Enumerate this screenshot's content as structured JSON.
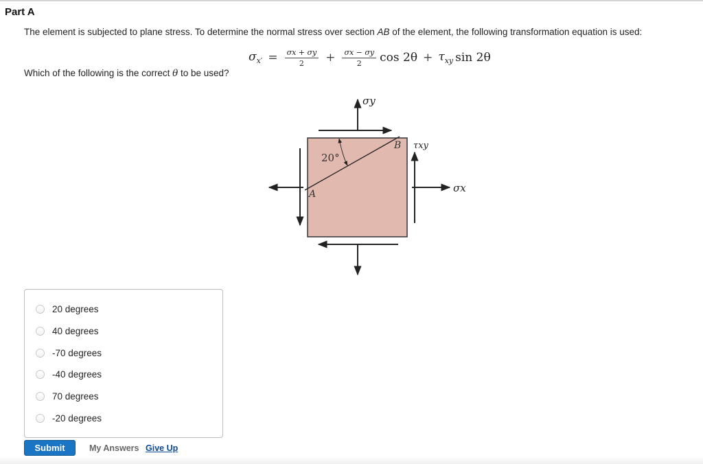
{
  "part": {
    "title": "Part A"
  },
  "intro": {
    "before": "The element is subjected to plane stress. To determine the normal stress over section ",
    "section": "AB",
    "after": " of the element, the following transformation equation is used:"
  },
  "equation": {
    "lhs": "σ",
    "lhs_sub": "x′",
    "equals": "=",
    "frac1_num": "σx + σy",
    "frac1_den": "2",
    "plus1": "+",
    "frac2_num": "σx − σy",
    "frac2_den": "2",
    "cos": "cos 2θ",
    "plus2": "+",
    "tau": "τ",
    "tau_sub": "xy",
    "sin": "sin 2θ"
  },
  "question": {
    "before": "Which of the following is the correct ",
    "symbol": "θ",
    "after": " to be used?"
  },
  "diagram": {
    "fill_color": "#e2b9ae",
    "angle_label": "20°",
    "point_a": "A",
    "point_b": "B",
    "sigma_y": "σy",
    "sigma_x": "σx",
    "tau_xy": "τxy"
  },
  "choices": [
    {
      "label": "20 degrees",
      "selected": false
    },
    {
      "label": "40 degrees",
      "selected": false
    },
    {
      "label": "-70 degrees",
      "selected": false
    },
    {
      "label": "-40 degrees",
      "selected": false
    },
    {
      "label": "70 degrees",
      "selected": false
    },
    {
      "label": "-20 degrees",
      "selected": false
    }
  ],
  "actions": {
    "submit": "Submit",
    "my_answers": "My Answers",
    "give_up": "Give Up"
  },
  "colors": {
    "accent": "#1a75c4",
    "link": "#0a4a9c"
  }
}
